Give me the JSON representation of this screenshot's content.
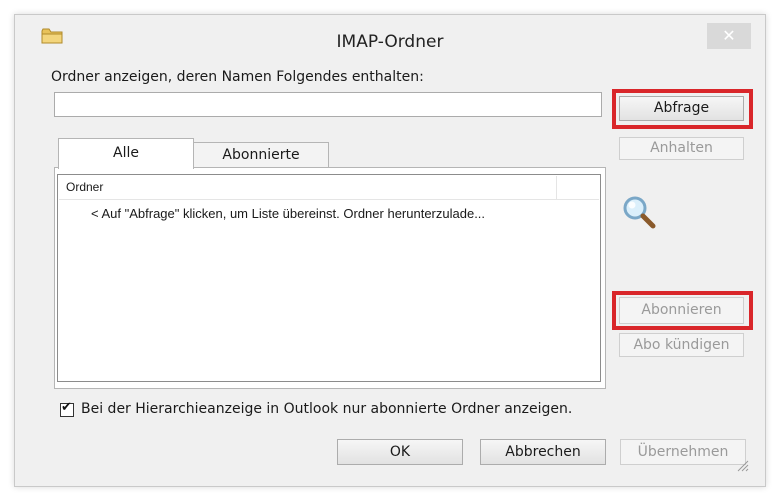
{
  "window": {
    "title": "IMAP-Ordner",
    "close_symbol": "✕"
  },
  "filter": {
    "label": "Ordner anzeigen, deren Namen Folgendes enthalten:",
    "value": ""
  },
  "buttons": {
    "query": "Abfrage",
    "stop": "Anhalten",
    "subscribe": "Abonnieren",
    "unsubscribe": "Abo kündigen",
    "ok": "OK",
    "cancel": "Abbrechen",
    "apply": "Übernehmen"
  },
  "tabs": [
    {
      "label": "Alle",
      "active": true
    },
    {
      "label": "Abonnierte",
      "active": false
    }
  ],
  "folder_list": {
    "column_header": "Ordner",
    "hint": "< Auf \"Abfrage\" klicken, um Liste übereinst. Ordner herunterzulade..."
  },
  "option": {
    "label": "Bei der Hierarchieanzeige in Outlook nur abonnierte Ordner anzeigen.",
    "checked": true
  },
  "colors": {
    "highlight": "#d9262a",
    "disabled_text": "#9a9a9a"
  },
  "icons": [
    "folder-icon",
    "search-icon",
    "close-icon",
    "resize-grip-icon"
  ]
}
